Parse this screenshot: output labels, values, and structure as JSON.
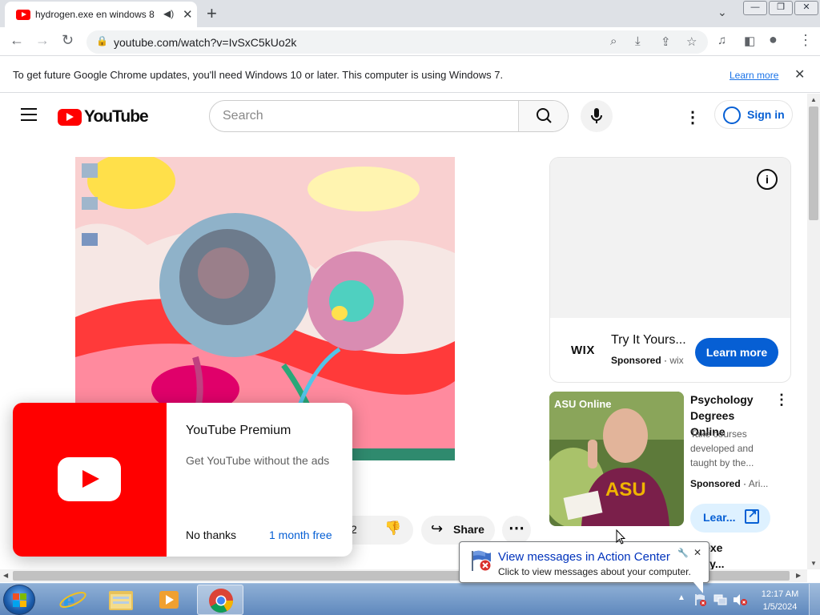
{
  "browser": {
    "tab_title": "hydrogen.exe en windows 8",
    "url": "youtube.com/watch?v=IvSxC5kUo2k"
  },
  "infobar": {
    "message": "To get future Google Chrome updates, you'll need Windows 10 or later. This computer is using Windows 7.",
    "link": "Learn more"
  },
  "youtube": {
    "logo_text": "YouTube",
    "search_placeholder": "Search",
    "sign_in": "Sign in"
  },
  "actions": {
    "dislike_count_partial": "2",
    "share_label": "Share"
  },
  "premium_popup": {
    "title": "YouTube Premium",
    "subtitle": "Get YouTube without the ads",
    "dismiss": "No thanks",
    "trial": "1 month free"
  },
  "ad_card": {
    "brand": "WIX",
    "headline": "Try It Yours...",
    "sponsored": "Sponsored",
    "domain": "wix",
    "cta": "Learn more"
  },
  "ad_thumb": {
    "logo": "ASU Online",
    "shirt_text": "ASU"
  },
  "ad2": {
    "title": "Psychology Degrees Online",
    "description": "Take courses developed and taught by the...",
    "sponsored": "Sponsored",
    "advertiser": "Ari...",
    "cta": "Lear..."
  },
  "next_video_title_partial": "...to.exe\n...epsy...",
  "next_video_line1": "to.exe",
  "next_video_line2": "epsy...",
  "balloon": {
    "title": "View messages in Action Center",
    "subtitle": "Click to view messages about your computer."
  },
  "clock": {
    "time": "12:17 AM",
    "date": "1/5/2024"
  },
  "colors": {
    "youtube_red": "#ff0000",
    "link_blue": "#065fd4",
    "chrome_blue": "#1a73e8"
  }
}
